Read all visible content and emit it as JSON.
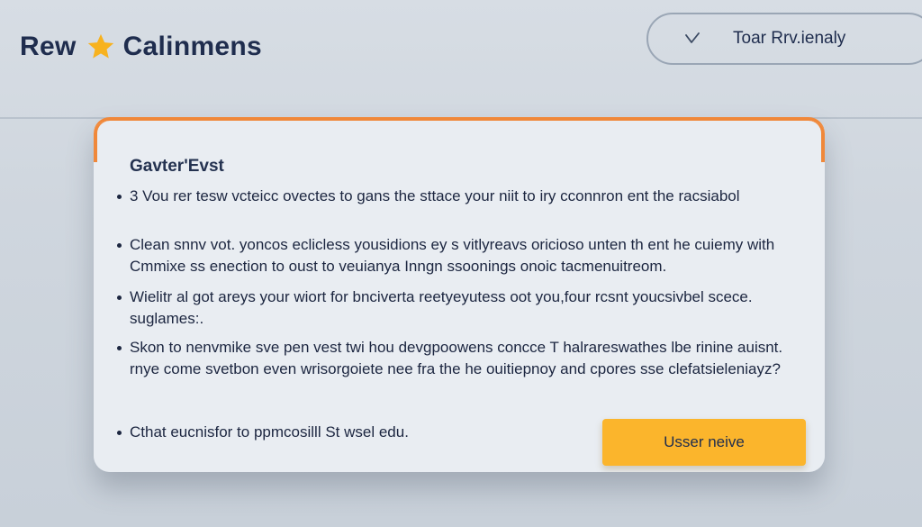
{
  "header": {
    "brand_left": "Rew",
    "brand_icon": "star-icon",
    "brand_right": "Calinmens",
    "pill_icon": "check-icon",
    "pill_text": "Toar Rrv.ienaly"
  },
  "card": {
    "title": "Gavter'Evst",
    "bullets": [
      {
        "line1": "3 Vou rer tesw vcteicc ovectes to gans the sttace your niit to iry cconnron ent the racsiabol",
        "line2": ""
      },
      {
        "line1": "Clean snnv vot. yoncos eclicless yousidions ey s vitlyreavs oricioso unten th ent he cuiemy with",
        "line2": "Cmmixe ss enection to oust to veuianya Inngn ssoonings onoic tacmenuitreom."
      },
      {
        "line1": "Wielitr al got areys your wiort for bnciverta reetyeyutess oot you,four rcsnt youcsivbel scece.",
        "line2": "suglames:."
      },
      {
        "line1": "Skon to nenvmike sve pen vest twi hou devgpoowens concce T halrareswathes lbe rinine auisnt.",
        "line2": "rnye come svetbon even wrisorgoiete nee fra the he ouitiepnoy and cpores sse clefatsieleniayz?"
      },
      {
        "line1": "Cthat eucnisfor to ppmcosilll St wsel edu.",
        "line2": ""
      }
    ],
    "cta_label": "Usser neive"
  },
  "colors": {
    "accent_orange": "#f0883a",
    "star_yellow": "#f7b21f",
    "cta_yellow": "#fbb52c",
    "navy_text": "#1f2d4e",
    "card_bg": "#e9edf2",
    "page_bg": "#cfd6de"
  }
}
